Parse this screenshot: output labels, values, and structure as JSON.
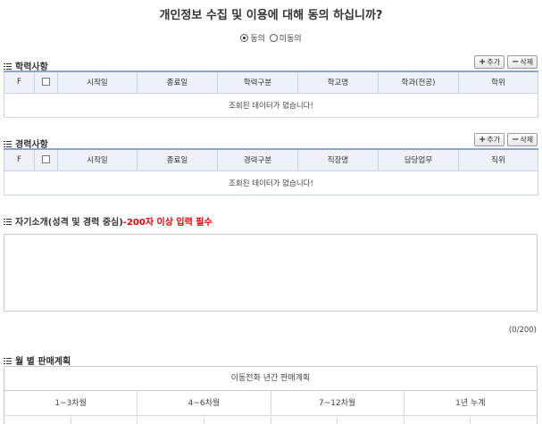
{
  "consent": {
    "title": "개인정보 수집 및 이용에 대해 동의 하십니까?",
    "agree_label": "동의",
    "disagree_label": "미동의",
    "selected": "agree"
  },
  "education": {
    "title": "학력사항",
    "add_label": "추가",
    "delete_label": "삭제",
    "columns": [
      "F",
      "",
      "시작일",
      "종료일",
      "학력구분",
      "학교명",
      "학과(전공)",
      "학위"
    ],
    "empty_message": "조회된 데이터가 없습니다!"
  },
  "career": {
    "title": "경력사항",
    "add_label": "추가",
    "delete_label": "삭제",
    "columns": [
      "F",
      "",
      "시작일",
      "종료일",
      "경력구분",
      "직장명",
      "담당업무",
      "직위"
    ],
    "empty_message": "조회된 데이터가 없습니다!"
  },
  "intro": {
    "title": "자기소개(성격 및 경력 중심)",
    "required_note": "-200자 이상 입력 필수",
    "text": "",
    "char_count": "(0/200)",
    "required_color": "#e00000"
  },
  "sales_plan": {
    "title": "월 별 판매계획",
    "table_title": "이동전화 년간 판매계획",
    "columns": [
      "1~3차월",
      "4~6차월",
      "7~12차월",
      "1년 누계"
    ]
  },
  "icons": {
    "section": "list-icon",
    "add": "plus-icon",
    "delete": "minus-icon"
  }
}
